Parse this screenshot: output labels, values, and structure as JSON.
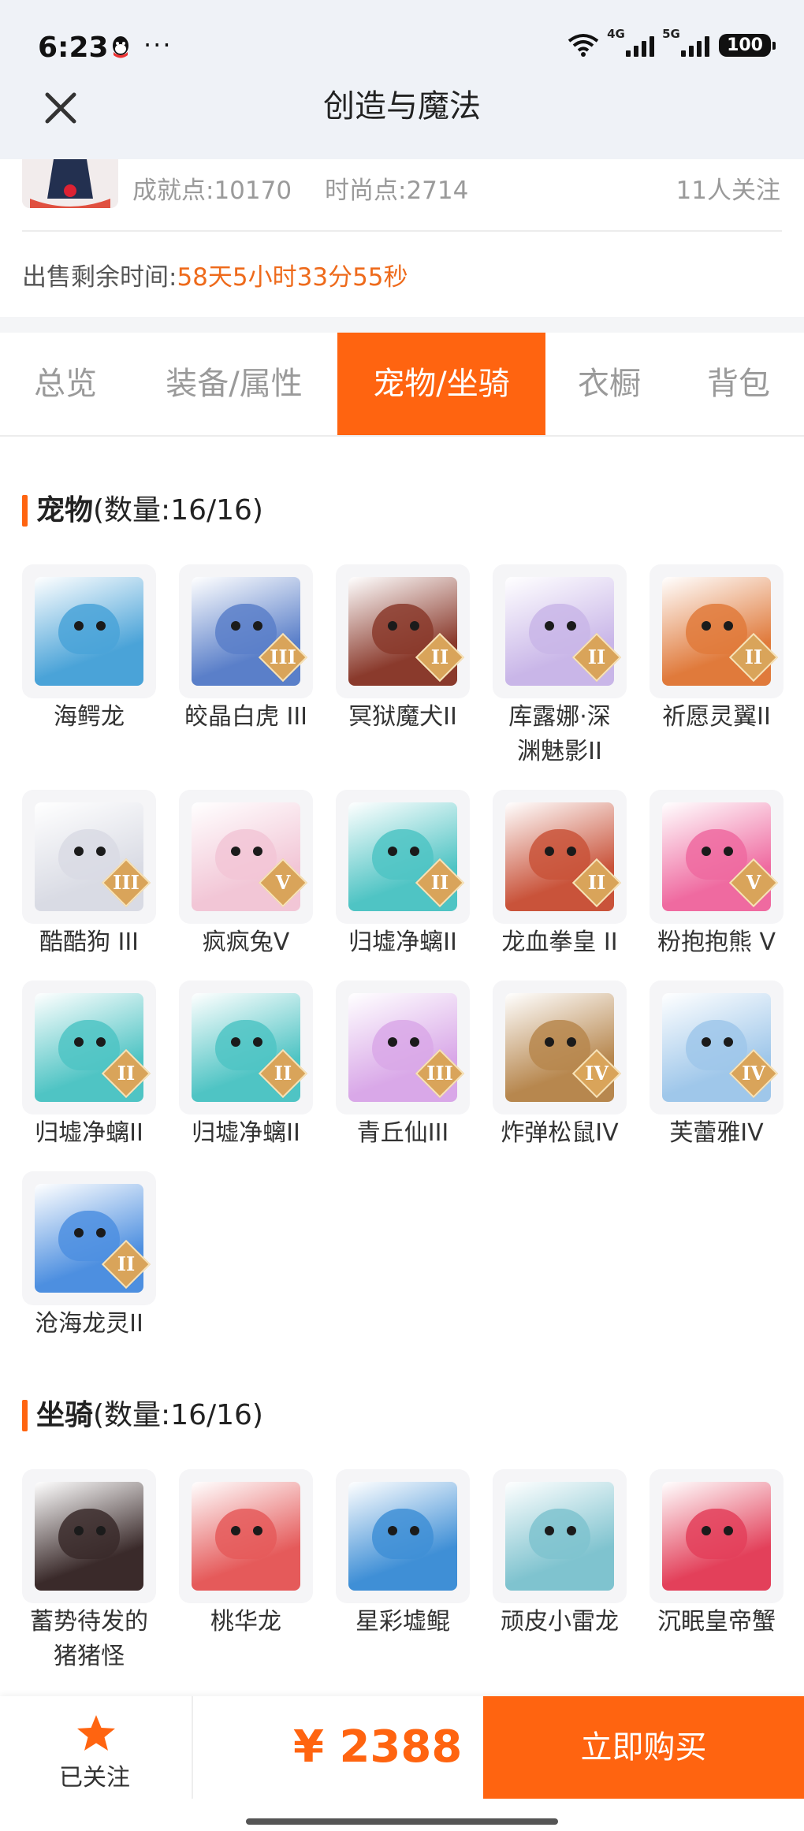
{
  "status_bar": {
    "time": "6:23",
    "more": "···",
    "net1": "4G",
    "net2": "5G",
    "battery": "100"
  },
  "nav": {
    "title": "创造与魔法",
    "close_icon": "close-icon"
  },
  "account": {
    "achievement": "成就点:10170",
    "fashion": "时尚点:2714",
    "followers": "11人关注",
    "sale_label": "出售剩余时间:",
    "sale_time": "58天5小时33分55秒"
  },
  "tabs": [
    "总览",
    "装备/属性",
    "宠物/坐骑",
    "衣橱",
    "背包"
  ],
  "active_tab": 2,
  "pets": {
    "title": "宠物",
    "count": "(数量:16/16)",
    "items": [
      {
        "name": "海鳄龙",
        "badge": "",
        "color": "#4aa3d8"
      },
      {
        "name": "皎晶白虎 III",
        "badge": "III",
        "color": "#5a7fc9"
      },
      {
        "name": "冥狱魔犬II",
        "badge": "II",
        "color": "#8a3a2c"
      },
      {
        "name": "库露娜·深\n渊魅影II",
        "badge": "II",
        "color": "#c9b6e8"
      },
      {
        "name": "祈愿灵翼II",
        "badge": "II",
        "color": "#e07a3b"
      },
      {
        "name": "酷酷狗 III",
        "badge": "III",
        "color": "#d9dbe4"
      },
      {
        "name": "疯疯兔V",
        "badge": "V",
        "color": "#f2c6d6"
      },
      {
        "name": "归墟净螭II",
        "badge": "II",
        "color": "#4fc4c4"
      },
      {
        "name": "龙血拳皇 II",
        "badge": "II",
        "color": "#c9533a"
      },
      {
        "name": "粉抱抱熊 V",
        "badge": "V",
        "color": "#ef6aa0"
      },
      {
        "name": "归墟净螭II",
        "badge": "II",
        "color": "#4fc4c4"
      },
      {
        "name": "归墟净螭II",
        "badge": "II",
        "color": "#4fc4c4"
      },
      {
        "name": "青丘仙III",
        "badge": "III",
        "color": "#d9a8e8"
      },
      {
        "name": "炸弹松鼠IV",
        "badge": "IV",
        "color": "#b7874e"
      },
      {
        "name": "芙蕾雅IV",
        "badge": "IV",
        "color": "#9fc7ea"
      },
      {
        "name": "沧海龙灵II",
        "badge": "II",
        "color": "#4d8fe0"
      }
    ]
  },
  "mounts": {
    "title": "坐骑",
    "count": "(数量:16/16)",
    "items": [
      {
        "name": "蓄势待发的\n猪猪怪",
        "color": "#3a2a2a"
      },
      {
        "name": "桃华龙",
        "color": "#e55a5a"
      },
      {
        "name": "星彩墟鲲",
        "color": "#3f8fd6"
      },
      {
        "name": "顽皮小雷龙",
        "color": "#7fc3cf"
      },
      {
        "name": "沉眠皇帝蟹",
        "color": "#e3405a"
      }
    ]
  },
  "bottom": {
    "follow_label": "已关注",
    "price": "¥ 2388",
    "buy_label": "立即购买"
  }
}
